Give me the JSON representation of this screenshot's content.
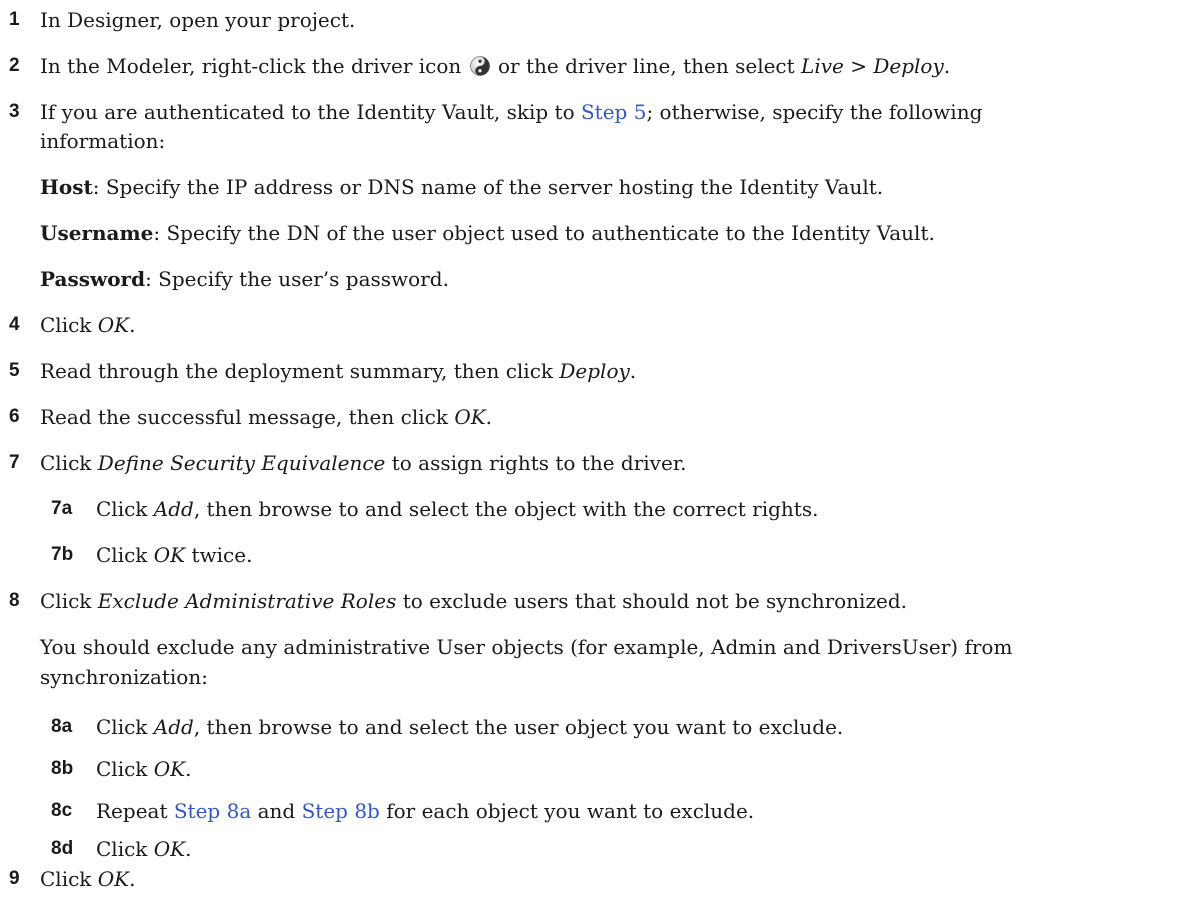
{
  "steps": {
    "s1": {
      "num": "1",
      "text": "In Designer, open your project."
    },
    "s2": {
      "num": "2",
      "pre": "In the Modeler, right-click the driver icon",
      "mid": "or the driver line, then select",
      "live": "Live",
      "sep": ">",
      "deploy": "Deploy",
      "end": "."
    },
    "s3": {
      "num": "3",
      "pre": "If you are authenticated to the Identity Vault, skip to",
      "link": "Step 5",
      "post": "; otherwise, specify the following",
      "line2": "information:"
    },
    "host": {
      "label": "Host",
      "text": ": Specify the IP address or DNS name of the server hosting the Identity Vault."
    },
    "username": {
      "label": "Username",
      "text": ": Specify the DN of the user object used to authenticate to the Identity Vault."
    },
    "password": {
      "label": "Password",
      "text": ": Specify the user’s password."
    },
    "s4": {
      "num": "4",
      "pre": "Click",
      "em": "OK",
      "post": "."
    },
    "s5": {
      "num": "5",
      "pre": "Read through the deployment summary, then click",
      "em": "Deploy",
      "post": "."
    },
    "s6": {
      "num": "6",
      "pre": "Read the successful message, then click",
      "em": "OK",
      "post": "."
    },
    "s7": {
      "num": "7",
      "pre": "Click",
      "em": "Define Security Equivalence",
      "post": "to assign rights to the driver."
    },
    "s7a": {
      "num": "7a",
      "pre": "Click",
      "em": "Add",
      "post": ", then browse to and select the object with the correct rights."
    },
    "s7b": {
      "num": "7b",
      "pre": "Click",
      "em": "OK",
      "post": "twice."
    },
    "s8": {
      "num": "8",
      "pre": "Click",
      "em": "Exclude Administrative Roles",
      "post": "to exclude users that should not be synchronized."
    },
    "s8note": {
      "text": "You should exclude any administrative User objects (for example, Admin and DriversUser) from synchronization:"
    },
    "s8a": {
      "num": "8a",
      "pre": "Click",
      "em": "Add",
      "post": ", then browse to and select the user object you want to exclude."
    },
    "s8b": {
      "num": "8b",
      "pre": "Click",
      "em": "OK",
      "post": "."
    },
    "s8c": {
      "num": "8c",
      "pre": "Repeat",
      "link1": "Step 8a",
      "and": "and",
      "link2": "Step 8b",
      "post": "for each object you want to exclude."
    },
    "s8d": {
      "num": "8d",
      "pre": "Click",
      "em": "OK",
      "post": "."
    },
    "s9": {
      "num": "9",
      "pre": "Click",
      "em": "OK",
      "post": "."
    }
  },
  "icons": {
    "driver": "yin-yang-driver-icon"
  },
  "colors": {
    "link": "#3355cc",
    "text": "#1a1a1a"
  }
}
